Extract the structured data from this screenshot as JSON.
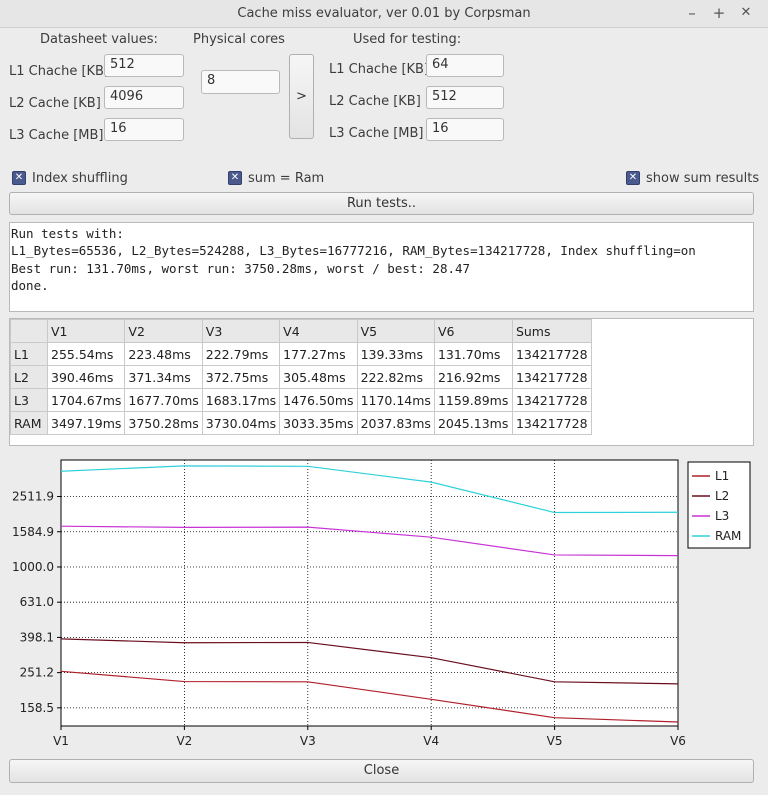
{
  "window": {
    "title": "Cache miss evaluator, ver 0.01 by Corpsman",
    "buttons": [
      "–",
      "+",
      "✕"
    ]
  },
  "datasheet": {
    "heading": "Datasheet values:",
    "l1_label": "L1 Chache [KB]",
    "l1_value": "512",
    "l2_label": "L2 Cache [KB]",
    "l2_value": "4096",
    "l3_label": "L3 Cache [MB]",
    "l3_value": "16"
  },
  "physical_cores": {
    "label": "Physical cores",
    "value": "8"
  },
  "transfer_button": ">",
  "testing": {
    "heading": "Used for testing:",
    "l1_label": "L1 Chache [KB]",
    "l1_value": "64",
    "l2_label": "L2 Cache [KB]",
    "l2_value": "512",
    "l3_label": "L3 Cache [MB]",
    "l3_value": "16"
  },
  "options": {
    "index_shuffling": "Index shuffling",
    "sum_ram": "sum = Ram",
    "show_sum": "show sum results",
    "check_mark": "✕"
  },
  "run_button": "Run tests..",
  "log": [
    "Run tests with:",
    "L1_Bytes=65536, L2_Bytes=524288, L3_Bytes=16777216, RAM_Bytes=134217728, Index shuffling=on",
    "Best run: 131.70ms, worst run: 3750.28ms, worst / best: 28.47",
    "done."
  ],
  "table": {
    "headers": [
      "",
      "V1",
      "V2",
      "V3",
      "V4",
      "V5",
      "V6",
      "Sums"
    ],
    "rows": [
      [
        "L1",
        "255.54ms",
        "223.48ms",
        "222.79ms",
        "177.27ms",
        "139.33ms",
        "131.70ms",
        "134217728"
      ],
      [
        "L2",
        "390.46ms",
        "371.34ms",
        "372.75ms",
        "305.48ms",
        "222.82ms",
        "216.92ms",
        "134217728"
      ],
      [
        "L3",
        "1704.67ms",
        "1677.70ms",
        "1683.17ms",
        "1476.50ms",
        "1170.14ms",
        "1159.89ms",
        "134217728"
      ],
      [
        "RAM",
        "3497.19ms",
        "3750.28ms",
        "3730.04ms",
        "3033.35ms",
        "2037.83ms",
        "2045.13ms",
        "134217728"
      ]
    ]
  },
  "chart_data": {
    "type": "line",
    "categories": [
      "V1",
      "V2",
      "V3",
      "V4",
      "V5",
      "V6"
    ],
    "y_scale": "log",
    "y_ticks": [
      "2511.9",
      "1584.9",
      "1000.0",
      "631.0",
      "398.1",
      "251.2",
      "158.5"
    ],
    "ylim": [
      125,
      4050
    ],
    "grid": true,
    "legend_position": "right",
    "series": [
      {
        "name": "L1",
        "color": "#b0202a",
        "values": [
          255.54,
          223.48,
          222.79,
          177.27,
          139.33,
          131.7
        ]
      },
      {
        "name": "L2",
        "color": "#6b0f1e",
        "values": [
          390.46,
          371.34,
          372.75,
          305.48,
          222.82,
          216.92
        ]
      },
      {
        "name": "L3",
        "color": "#c833d6",
        "values": [
          1704.67,
          1677.7,
          1683.17,
          1476.5,
          1170.14,
          1159.89
        ]
      },
      {
        "name": "RAM",
        "color": "#2ed1d9",
        "values": [
          3497.19,
          3750.28,
          3730.04,
          3033.35,
          2037.83,
          2045.13
        ]
      }
    ]
  },
  "close_button": "Close"
}
